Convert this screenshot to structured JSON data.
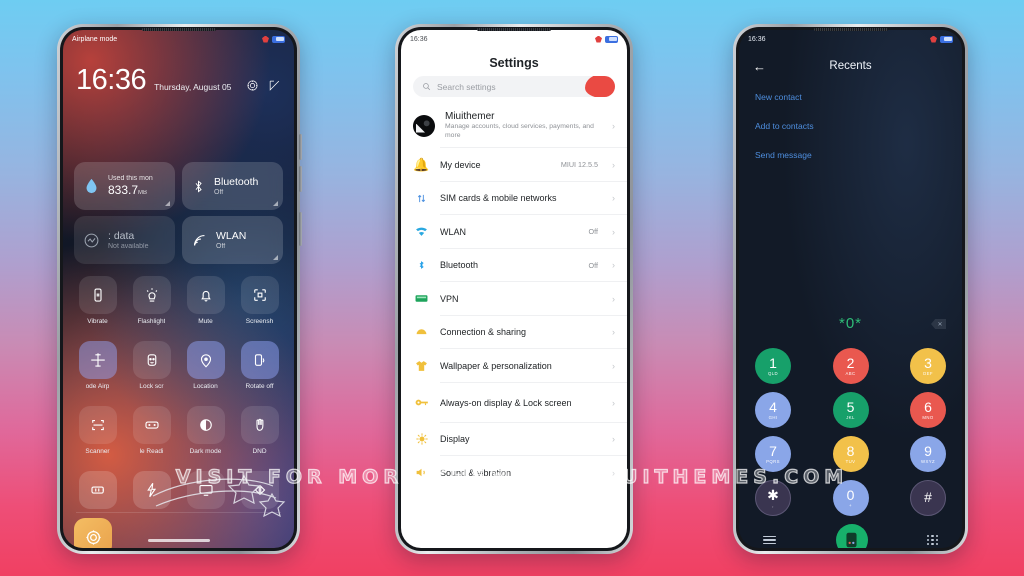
{
  "background": {
    "top_color": "#6ECDF2",
    "bottom_color": "#F04062"
  },
  "watermark": {
    "text": "VISIT FOR MORE THEMES - MIUITHEMES.COM"
  },
  "phone1": {
    "name": "control-center",
    "statusbar": {
      "left_text": "Airplane mode",
      "signal_icon": "signal-icon",
      "battery_icon": "battery-icon"
    },
    "clock": {
      "time": "16:36",
      "date": "Thursday, August 05"
    },
    "header_icons": [
      {
        "name": "settings-gear-icon"
      },
      {
        "name": "edit-icon"
      }
    ],
    "big_tiles": [
      {
        "name": "data-usage",
        "icon": "water-drop-icon",
        "line1": "Used this mon",
        "value": "833.7",
        "unit": "MB",
        "state": "active"
      },
      {
        "name": "bluetooth",
        "icon": "bluetooth-icon",
        "title": "Bluetooth",
        "sub": "Off",
        "state": "active"
      },
      {
        "name": "mobile-data",
        "icon": "data-icon",
        "title": ": data",
        "sub": "Not available",
        "state": "dim"
      },
      {
        "name": "wlan",
        "icon": "wifi-icon",
        "title": "WLAN",
        "sub": "Off",
        "state": "active"
      }
    ],
    "tiles": [
      {
        "label": "Vibrate",
        "icon": "vibrate-icon",
        "state": "off"
      },
      {
        "label": "Flashlight",
        "icon": "flashlight-icon",
        "state": "off"
      },
      {
        "label": "Mute",
        "icon": "bell-mute-icon",
        "state": "off"
      },
      {
        "label": "Screensh",
        "icon": "screenshot-icon",
        "state": "off"
      },
      {
        "label": "ode   Airp",
        "icon": "airplane-icon",
        "state": "on"
      },
      {
        "label": "Lock scr",
        "icon": "face-unlock-icon",
        "state": "off"
      },
      {
        "label": "Location",
        "icon": "location-icon",
        "state": "on"
      },
      {
        "label": "Rotate off",
        "icon": "rotate-icon",
        "state": "on"
      },
      {
        "label": "Scanner",
        "icon": "scanner-icon",
        "state": "off"
      },
      {
        "label": "le   Readi",
        "icon": "reading-mode-icon",
        "state": "off"
      },
      {
        "label": "Dark mode",
        "icon": "moon-icon",
        "state": "off"
      },
      {
        "label": "DND",
        "icon": "hand-icon",
        "state": "off"
      }
    ],
    "tiles_row4": [
      {
        "label": "",
        "icon": "battery-saver-icon",
        "state": "warm"
      },
      {
        "label": "",
        "icon": "lightning-icon",
        "state": "warm"
      },
      {
        "label": "",
        "icon": "cast-icon",
        "state": "off"
      },
      {
        "label": "",
        "icon": "sync-icon",
        "state": "off"
      }
    ],
    "brightness": {
      "name": "brightness-tile",
      "icon": "brightness-icon"
    }
  },
  "phone2": {
    "name": "settings",
    "statusbar": {
      "left_text": "16:36",
      "signal_icon": "signal-icon",
      "battery_icon": "battery-icon"
    },
    "title": "Settings",
    "search": {
      "placeholder": "Search settings",
      "icon": "search-icon"
    },
    "account": {
      "name": "Miuithemer",
      "sub": "Manage accounts, cloud services, payments, and more",
      "avatar": "user-avatar"
    },
    "items": [
      {
        "label": "My device",
        "icon": "bell-icon",
        "value": "MIUI 12.5.5"
      },
      {
        "label": "SIM cards & mobile networks",
        "icon": "sim-icon",
        "value": ""
      },
      {
        "label": "WLAN",
        "icon": "wifi-icon",
        "value": "Off"
      },
      {
        "label": "Bluetooth",
        "icon": "bluetooth-icon",
        "value": "Off"
      },
      {
        "label": "VPN",
        "icon": "vpn-icon",
        "value": ""
      },
      {
        "label": "Connection & sharing",
        "icon": "share-icon",
        "value": ""
      },
      {
        "label": "Wallpaper & personalization",
        "icon": "shirt-icon",
        "value": ""
      },
      {
        "label": "Always-on display & Lock screen",
        "icon": "key-icon",
        "value": ""
      },
      {
        "label": "Display",
        "icon": "sun-icon",
        "value": ""
      },
      {
        "label": "Sound & vibration",
        "icon": "speaker-icon",
        "value": ""
      }
    ],
    "chevron": "›"
  },
  "phone3": {
    "name": "dialer-recents",
    "statusbar": {
      "left_text": "16:36",
      "signal_icon": "signal-icon",
      "battery_icon": "battery-icon"
    },
    "back_icon": "back-arrow-icon",
    "title": "Recents",
    "links": [
      {
        "label": "New contact"
      },
      {
        "label": "Add to contacts"
      },
      {
        "label": "Send message"
      }
    ],
    "number_display": "*0*",
    "delete_icon": "backspace-icon",
    "keypad": [
      [
        {
          "d": "1",
          "l": "QLD",
          "c": "#17a06a"
        },
        {
          "d": "2",
          "l": "ABC",
          "c": "#e9584f"
        },
        {
          "d": "3",
          "l": "DEF",
          "c": "#f2c14a"
        }
      ],
      [
        {
          "d": "4",
          "l": "GHI",
          "c": "#8aa6e8"
        },
        {
          "d": "5",
          "l": "JKL",
          "c": "#17a06a"
        },
        {
          "d": "6",
          "l": "MNO",
          "c": "#e9584f"
        }
      ],
      [
        {
          "d": "7",
          "l": "PQRS",
          "c": "#8aa6e8"
        },
        {
          "d": "8",
          "l": "TUV",
          "c": "#f2c14a"
        },
        {
          "d": "9",
          "l": "WXYZ",
          "c": "#8aa6e8"
        }
      ],
      [
        {
          "d": "✱",
          "l": ",",
          "c": "#3a3550"
        },
        {
          "d": "0",
          "l": "+",
          "c": "#8aa6e8"
        },
        {
          "d": "#",
          "l": "",
          "c": "#3a3550"
        }
      ]
    ],
    "bottom": {
      "menu_icon": "menu-icon",
      "call_icon": "call-button-icon",
      "keypad_icon": "keypad-icon",
      "call_color": "#17b06b"
    }
  }
}
